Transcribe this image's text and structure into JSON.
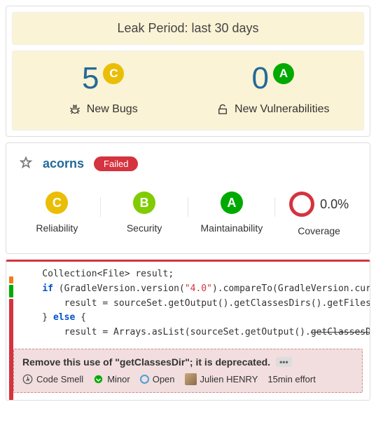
{
  "leak": {
    "header": "Leak Period: last 30 days",
    "bugs": {
      "count": "5",
      "grade": "C",
      "label": "New Bugs"
    },
    "vuln": {
      "count": "0",
      "grade": "A",
      "label": "New Vulnerabilities"
    }
  },
  "project": {
    "name": "acorns",
    "status": "Failed",
    "reliability": {
      "grade": "C",
      "label": "Reliability"
    },
    "security": {
      "grade": "B",
      "label": "Security"
    },
    "maintainability": {
      "grade": "A",
      "label": "Maintainability"
    },
    "coverage": {
      "value": "0.0%",
      "label": "Coverage"
    }
  },
  "code": {
    "l1_a": "    Collection<File> result;",
    "l2_kw": "if",
    "l2_a": " (GradleVersion.version(",
    "l2_str": "\"4.0\"",
    "l2_b": ").compareTo(GradleVersion.cur",
    "l3_a": "        result = sourceSet.getOutput().getClassesDirs().getFiles()",
    "l4_a": "    } ",
    "l4_kw": "else",
    "l4_b": " {",
    "l5_a": "        result = Arrays.asList(sourceSet.getOutput().",
    "l5_dep": "getClassesDir"
  },
  "issue": {
    "message": "Remove this use of \"getClassesDir\"; it is deprecated.",
    "type": "Code Smell",
    "severity": "Minor",
    "status": "Open",
    "assignee": "Julien HENRY",
    "effort": "15min effort"
  }
}
